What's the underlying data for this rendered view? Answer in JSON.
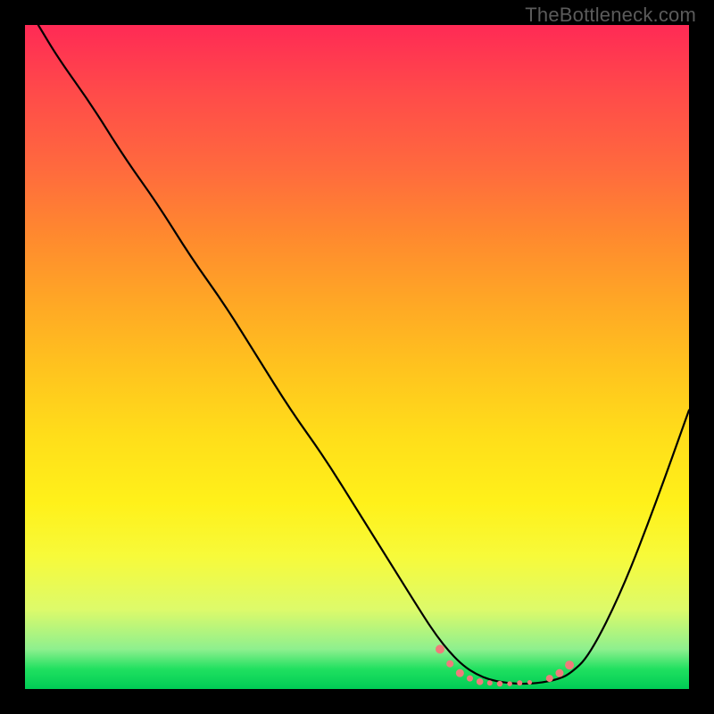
{
  "watermark": "TheBottleneck.com",
  "chart_data": {
    "type": "line",
    "title": "",
    "xlabel": "",
    "ylabel": "",
    "xlim": [
      0,
      100
    ],
    "ylim": [
      0,
      100
    ],
    "grid": false,
    "legend": false,
    "series": [
      {
        "name": "curve",
        "color": "#000000",
        "x": [
          2,
          5,
          10,
          15,
          20,
          25,
          30,
          35,
          40,
          45,
          50,
          55,
          60,
          62,
          64,
          66,
          68,
          70,
          72,
          74,
          76,
          78,
          80,
          82,
          85,
          90,
          95,
          100
        ],
        "y": [
          100,
          95,
          88,
          80,
          73,
          65,
          58,
          50,
          42,
          35,
          27,
          19,
          11,
          8,
          5.5,
          3.5,
          2.2,
          1.4,
          1.0,
          0.8,
          0.8,
          1.0,
          1.4,
          2.2,
          5,
          15,
          28,
          42
        ]
      }
    ],
    "markers": [
      {
        "x": 62.5,
        "y": 6.0,
        "r": 5.0,
        "color": "#f07b7b"
      },
      {
        "x": 64.0,
        "y": 3.8,
        "r": 4.0,
        "color": "#f07b7b"
      },
      {
        "x": 65.5,
        "y": 2.4,
        "r": 4.5,
        "color": "#f07b7b"
      },
      {
        "x": 67.0,
        "y": 1.6,
        "r": 3.5,
        "color": "#f07b7b"
      },
      {
        "x": 68.5,
        "y": 1.1,
        "r": 3.8,
        "color": "#f07b7b"
      },
      {
        "x": 70.0,
        "y": 0.9,
        "r": 3.0,
        "color": "#f07b7b"
      },
      {
        "x": 71.5,
        "y": 0.8,
        "r": 3.2,
        "color": "#f07b7b"
      },
      {
        "x": 73.0,
        "y": 0.8,
        "r": 2.8,
        "color": "#f07b7b"
      },
      {
        "x": 74.5,
        "y": 0.9,
        "r": 3.0,
        "color": "#f07b7b"
      },
      {
        "x": 76.0,
        "y": 1.0,
        "r": 2.6,
        "color": "#f07b7b"
      },
      {
        "x": 79.0,
        "y": 1.6,
        "r": 4.0,
        "color": "#f07b7b"
      },
      {
        "x": 80.5,
        "y": 2.4,
        "r": 4.5,
        "color": "#f07b7b"
      },
      {
        "x": 82.0,
        "y": 3.6,
        "r": 5.0,
        "color": "#f07b7b"
      }
    ],
    "background_gradient_stops": [
      {
        "pos": 0.0,
        "color": "#ff2a55"
      },
      {
        "pos": 0.5,
        "color": "#ffc41e"
      },
      {
        "pos": 0.8,
        "color": "#f7fa3a"
      },
      {
        "pos": 0.97,
        "color": "#20e060"
      },
      {
        "pos": 1.0,
        "color": "#00cc55"
      }
    ]
  }
}
